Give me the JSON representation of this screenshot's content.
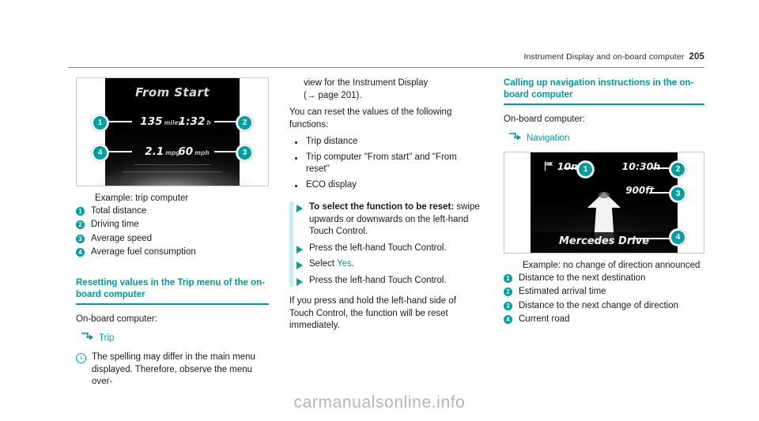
{
  "header": {
    "title": "Instrument Display and on-board computer",
    "page_number": "205"
  },
  "left_column": {
    "trip_display": {
      "title": "From Start",
      "readouts": [
        {
          "callout": "1",
          "value": "135",
          "unit": "miles"
        },
        {
          "callout": "2",
          "value": "1:32",
          "unit": "h"
        },
        {
          "callout": "3",
          "value": "60",
          "unit": "mph"
        },
        {
          "callout": "4",
          "value": "2.1",
          "unit": "mpg"
        }
      ]
    },
    "caption_title": "Example: trip computer",
    "legend": [
      {
        "num": "1",
        "text": "Total distance"
      },
      {
        "num": "2",
        "text": "Driving time"
      },
      {
        "num": "3",
        "text": "Average speed"
      },
      {
        "num": "4",
        "text": "Average fuel consumption"
      }
    ],
    "heading": "Resetting values in the Trip menu of the on-board computer",
    "intro": "On-board computer:",
    "menu_path": {
      "icon": "menu-arrow-icon",
      "label": "Trip"
    },
    "note": {
      "icon": "info-icon",
      "text": "The spelling may differ in the main menu displayed. Therefore, observe the menu over-"
    }
  },
  "middle_column": {
    "continued_text_line1": "view for the Instrument Display",
    "continued_text_line2": "(→ page 201).",
    "reset_intro": "You can reset the values of the following functions:",
    "bullets": [
      "Trip distance",
      "Trip computer \"From start\" and \"From reset\"",
      "ECO display"
    ],
    "steps": [
      {
        "bold": "To select the function to be reset:",
        "rest": " swipe upwards or downwards on the left-hand Touch Control."
      },
      {
        "bold": "",
        "rest": "Press the left-hand Touch Control."
      },
      {
        "bold": "",
        "rest": "Select ",
        "accent": "Yes",
        "tail": "."
      },
      {
        "bold": "",
        "rest": "Press the left-hand Touch Control."
      }
    ],
    "trailing": "If you press and hold the left-hand side of Touch Control, the function will be reset immediately."
  },
  "right_column": {
    "heading": "Calling up navigation instructions in the on-board computer",
    "intro": "On-board computer:",
    "menu_path": {
      "icon": "menu-arrow-icon",
      "label": "Navigation"
    },
    "nav_display": {
      "distance_to_destination": "10mi",
      "arrival_time": "10:30h",
      "distance_next_turn": "900ft",
      "current_road": "Mercedes Drive",
      "flag_icon": "destination-flag-icon",
      "arrow_icon": "straight-ahead-arrow-icon"
    },
    "caption_title": "Example: no change of direction announced",
    "legend": [
      {
        "num": "1",
        "text": "Distance to the next destination"
      },
      {
        "num": "2",
        "text": "Estimated arrival time"
      },
      {
        "num": "3",
        "text": "Distance to the next change of direction"
      },
      {
        "num": "4",
        "text": "Current road"
      }
    ]
  },
  "watermark": "carmanualsonline.info",
  "colors": {
    "accent_teal": "#009a9a",
    "callout_teal": "#00a0a0",
    "step_bar": "#c9ecec",
    "rule_gray": "#8a8a8a"
  }
}
